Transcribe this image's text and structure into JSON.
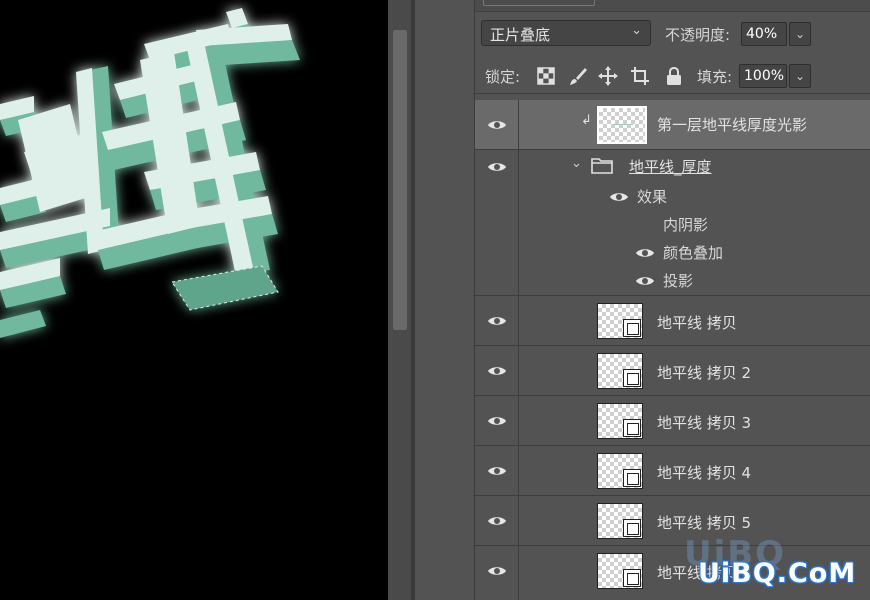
{
  "layers_panel": {
    "blend_mode": "正片叠底",
    "opacity_label": "不透明度:",
    "opacity_value": "40%",
    "lock_label": "锁定:",
    "fill_label": "填充:",
    "fill_value": "100%",
    "layers": [
      {
        "name": "第一层地平线厚度光影",
        "selected": true,
        "clipped": true
      },
      {
        "name": "地平线_厚度",
        "type": "group"
      },
      {
        "name": "地平线 拷贝"
      },
      {
        "name": "地平线 拷贝 2"
      },
      {
        "name": "地平线 拷贝 3"
      },
      {
        "name": "地平线 拷贝 4"
      },
      {
        "name": "地平线 拷贝 5"
      },
      {
        "name": "地平线 拷贝 6"
      }
    ],
    "effects": {
      "label": "效果",
      "items": [
        "内阴影",
        "颜色叠加",
        "投影"
      ]
    }
  },
  "canvas": {
    "glyph": "线"
  },
  "watermark": {
    "faint": "UiBQ",
    "text": "UiBQ.CoM"
  },
  "colors": {
    "panel_bg": "#535353",
    "selected_row": "#6a6a6a",
    "text_face": "#dff0ea",
    "text_side": "#6fb89e"
  }
}
